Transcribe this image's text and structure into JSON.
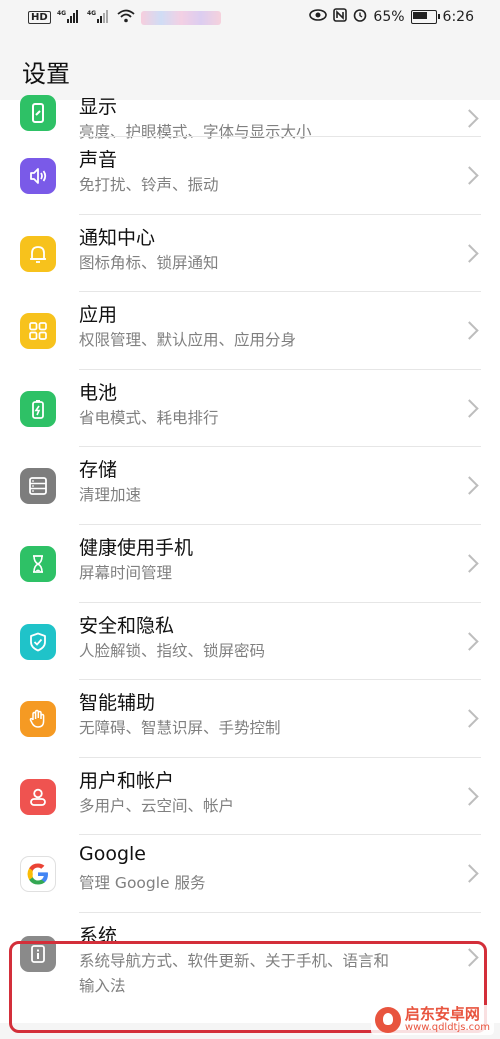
{
  "status_bar": {
    "network_1": "4G",
    "network_2": "4G",
    "hd_label": "HD",
    "battery_percent": "65%",
    "time": "6:26",
    "icons": [
      "hd-icon",
      "signal-icon",
      "signal-icon",
      "wifi-icon",
      "eye-comfort-icon",
      "nfc-icon",
      "alarm-icon",
      "battery-icon"
    ]
  },
  "header": {
    "title": "设置"
  },
  "items": [
    {
      "name": "显示",
      "sub": "亮度、护眼模式、字体与显示大小",
      "color": "#2ec166",
      "icon": "phone-display-icon"
    },
    {
      "name": "声音",
      "sub": "免打扰、铃声、振动",
      "color": "#7a5ae8",
      "icon": "speaker-icon"
    },
    {
      "name": "通知中心",
      "sub": "图标角标、锁屏通知",
      "color": "#f7c21c",
      "icon": "bell-icon"
    },
    {
      "name": "应用",
      "sub": "权限管理、默认应用、应用分身",
      "color": "#f7c21c",
      "icon": "apps-grid-icon"
    },
    {
      "name": "电池",
      "sub": "省电模式、耗电排行",
      "color": "#2ec166",
      "icon": "battery-icon"
    },
    {
      "name": "存储",
      "sub": "清理加速",
      "color": "#7d7d7d",
      "icon": "storage-icon"
    },
    {
      "name": "健康使用手机",
      "sub": "屏幕时间管理",
      "color": "#2ec166",
      "icon": "hourglass-icon"
    },
    {
      "name": "安全和隐私",
      "sub": "人脸解锁、指纹、锁屏密码",
      "color": "#1fc3c9",
      "icon": "shield-icon"
    },
    {
      "name": "智能辅助",
      "sub": "无障碍、智慧识屏、手势控制",
      "color": "#f59a23",
      "icon": "hand-icon"
    },
    {
      "name": "用户和帐户",
      "sub": "多用户、云空间、帐户",
      "color": "#ef5350",
      "icon": "user-icon"
    },
    {
      "name": "Google",
      "sub": "管理 Google 服务",
      "color": "#ffffff",
      "icon": "google-icon"
    },
    {
      "name": "系统",
      "sub": "系统导航方式、软件更新、关于手机、语言和",
      "sub2": "输入法",
      "color": "#8a8a8a",
      "icon": "info-icon"
    }
  ],
  "watermark": {
    "line1": "启东安卓网",
    "line2": "www.qdldtjs.com"
  }
}
